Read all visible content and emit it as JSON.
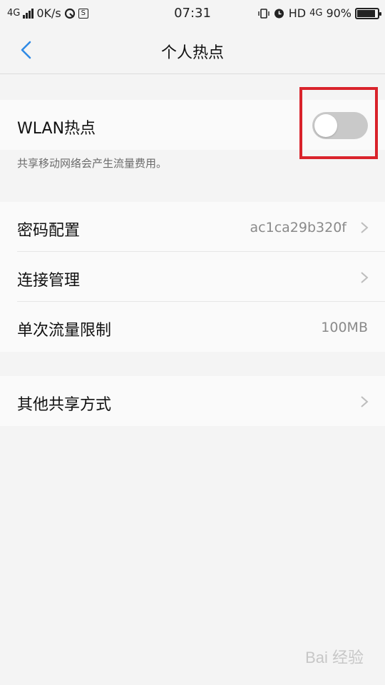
{
  "status_bar": {
    "network_left": "4G",
    "speed": "0K/s",
    "time": "07:31",
    "hd": "HD",
    "network_right": "4G",
    "battery_text": "90%",
    "battery_level": 0.9
  },
  "header": {
    "title": "个人热点",
    "back_icon": "chevron-left-icon"
  },
  "hotspot": {
    "label": "WLAN热点",
    "enabled": false,
    "hint": "共享移动网络会产生流量费用。"
  },
  "settings": [
    {
      "label": "密码配置",
      "value": "ac1ca29b320f",
      "chevron": true
    },
    {
      "label": "连接管理",
      "value": "",
      "chevron": true
    },
    {
      "label": "单次流量限制",
      "value": "100MB",
      "chevron": false
    }
  ],
  "other": {
    "label": "其他共享方式"
  },
  "colors": {
    "accent": "#2f8ae5",
    "highlight": "#d9232b",
    "toggle_off": "#c9c9c9"
  },
  "watermark": "Bai 经验"
}
